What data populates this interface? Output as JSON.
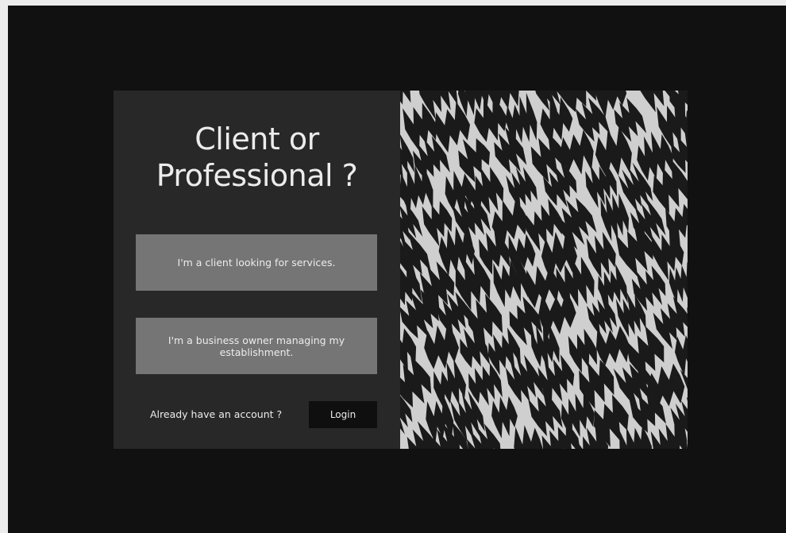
{
  "card": {
    "title_line1": "Client or",
    "title_line2": "Professional ?",
    "client_option_label": "I'm a client looking for services.",
    "business_option_label": "I'm a business owner managing my establishment.",
    "login_prompt": "Already have an account ?",
    "login_label": "Login"
  },
  "colors": {
    "page_background": "#111111",
    "card_background": "#282828",
    "option_button": "#757575",
    "login_button": "#0f0f0f",
    "text": "#ececec",
    "pattern_light": "#cfcfcf",
    "pattern_dark": "#1a1a1a"
  }
}
